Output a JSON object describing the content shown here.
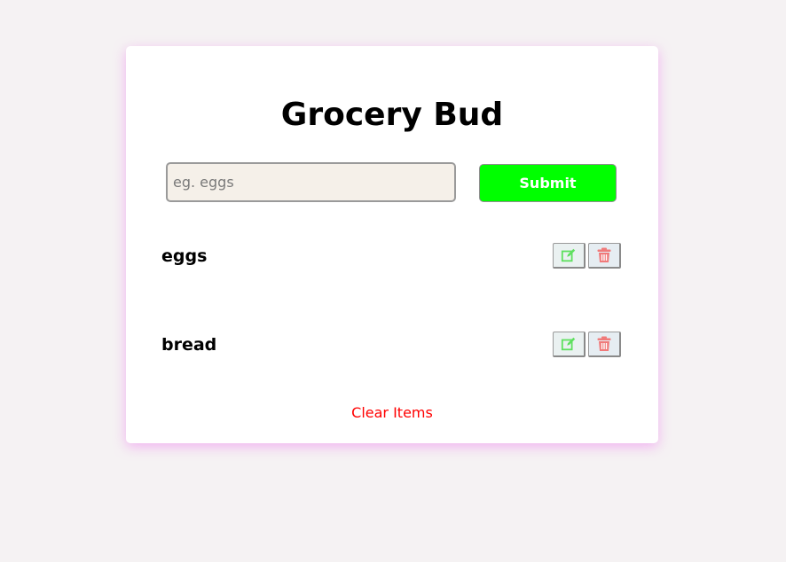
{
  "app": {
    "title": "Grocery Bud"
  },
  "form": {
    "input_value": "",
    "input_placeholder": "eg. eggs",
    "submit_label": "Submit"
  },
  "items": [
    {
      "label": "eggs",
      "edit_icon": "edit-icon",
      "delete_icon": "trash-icon"
    },
    {
      "label": "bread",
      "edit_icon": "edit-icon",
      "delete_icon": "trash-icon"
    }
  ],
  "footer": {
    "clear_label": "Clear Items"
  },
  "colors": {
    "accent_submit": "#00ff00",
    "edit_icon": "#5fe05f",
    "delete_icon": "#f07a7a",
    "clear_text": "#ff0000",
    "card_shadow": "#ee82ee"
  }
}
